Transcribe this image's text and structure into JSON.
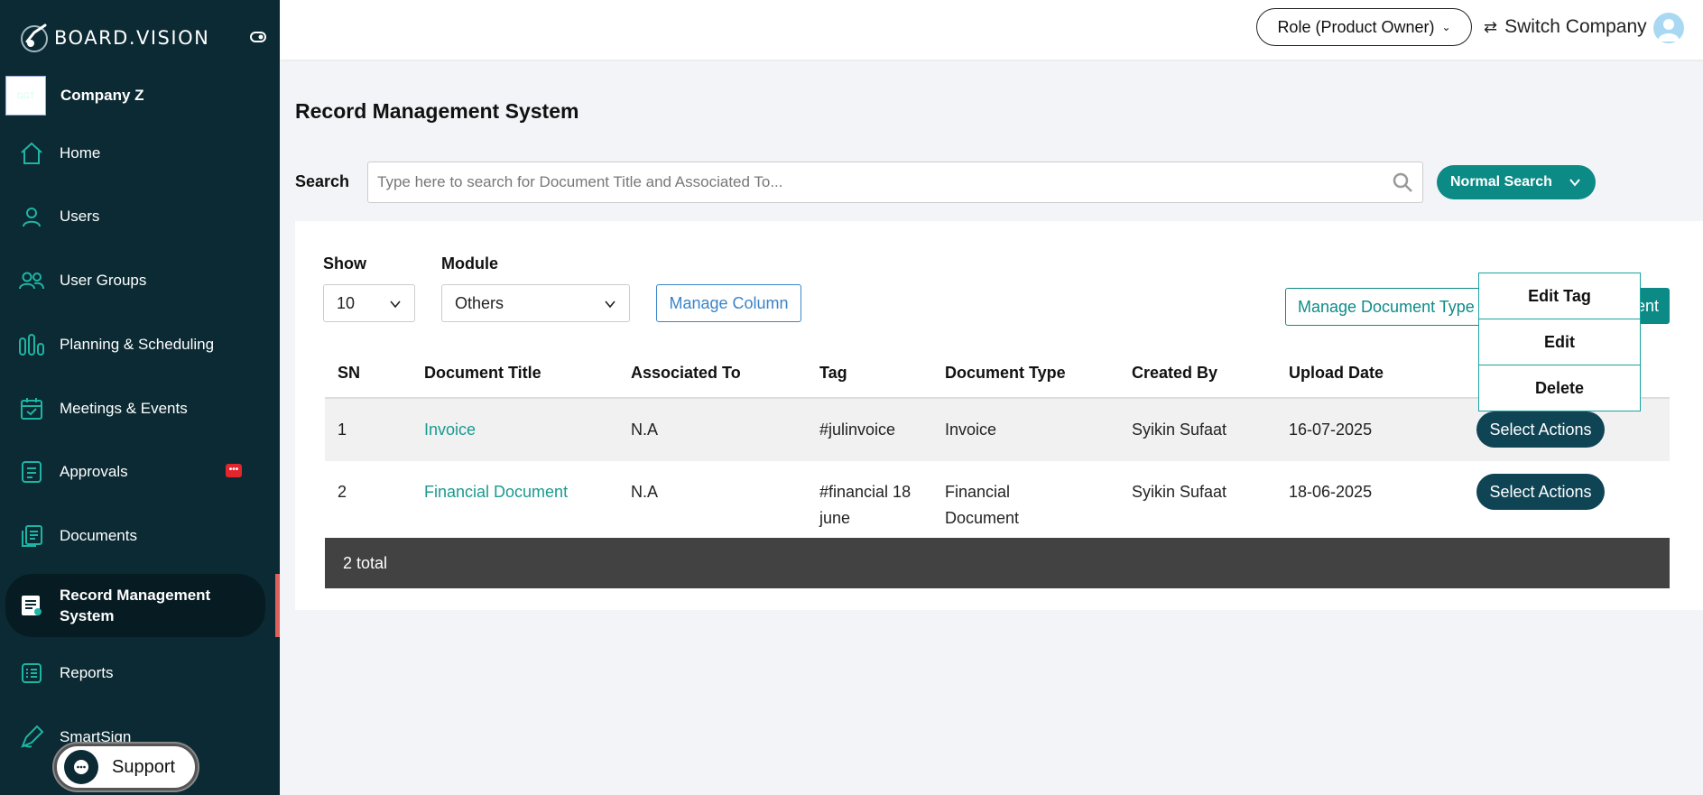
{
  "brand": {
    "name": "BOARD.VISION"
  },
  "company": {
    "logo_text": "GGT",
    "name": "Company Z"
  },
  "sidebar": {
    "items": [
      {
        "label": "Home",
        "icon": "home-icon"
      },
      {
        "label": "Users",
        "icon": "user-icon"
      },
      {
        "label": "User Groups",
        "icon": "user-group-icon"
      },
      {
        "label": "Planning & Scheduling",
        "icon": "planning-icon"
      },
      {
        "label": "Meetings & Events",
        "icon": "calendar-icon"
      },
      {
        "label": "Approvals",
        "icon": "approvals-icon",
        "badge": "•••"
      },
      {
        "label": "Documents",
        "icon": "documents-icon"
      },
      {
        "label": "Record Management\nSystem",
        "icon": "record-icon",
        "active": true
      },
      {
        "label": "Reports",
        "icon": "reports-icon"
      },
      {
        "label": "SmartSign",
        "icon": "pen-icon"
      }
    ],
    "support_label": "Support"
  },
  "header": {
    "role_label": "Role (Product Owner)",
    "switch_company_label": "Switch Company"
  },
  "main": {
    "title": "Record Management System",
    "search": {
      "label": "Search",
      "placeholder": "Type here to search for Document Title and Associated To...",
      "mode_label": "Normal Search"
    },
    "filters": {
      "show_label": "Show",
      "show_value": "10",
      "module_label": "Module",
      "module_value": "Others",
      "manage_column_label": "Manage Column",
      "manage_doc_type_label": "Manage Document Type",
      "add_document_partial": "ent"
    },
    "table": {
      "columns": [
        "SN",
        "Document Title",
        "Associated To",
        "Tag",
        "Document Type",
        "Created By",
        "Upload Date"
      ],
      "rows": [
        {
          "sn": "1",
          "title": "Invoice",
          "associated": "N.A",
          "tag": "#julinvoice",
          "type": "Invoice",
          "created_by": "Syikin Sufaat",
          "date": "16-07-2025",
          "action": "Select Actions"
        },
        {
          "sn": "2",
          "title": "Financial Document",
          "associated": "N.A",
          "tag": "#financial 18 june",
          "type": "Financial Document",
          "created_by": "Syikin Sufaat",
          "date": "18-06-2025",
          "action": "Select Actions"
        }
      ],
      "total_label": "2 total"
    },
    "actions_menu": [
      "Edit Tag",
      "Edit",
      "Delete"
    ]
  },
  "colors": {
    "sidebar_bg": "#0b2a33",
    "accent_teal": "#0c8a86",
    "action_btn": "#0f4455",
    "active_marker": "#e0605c"
  }
}
